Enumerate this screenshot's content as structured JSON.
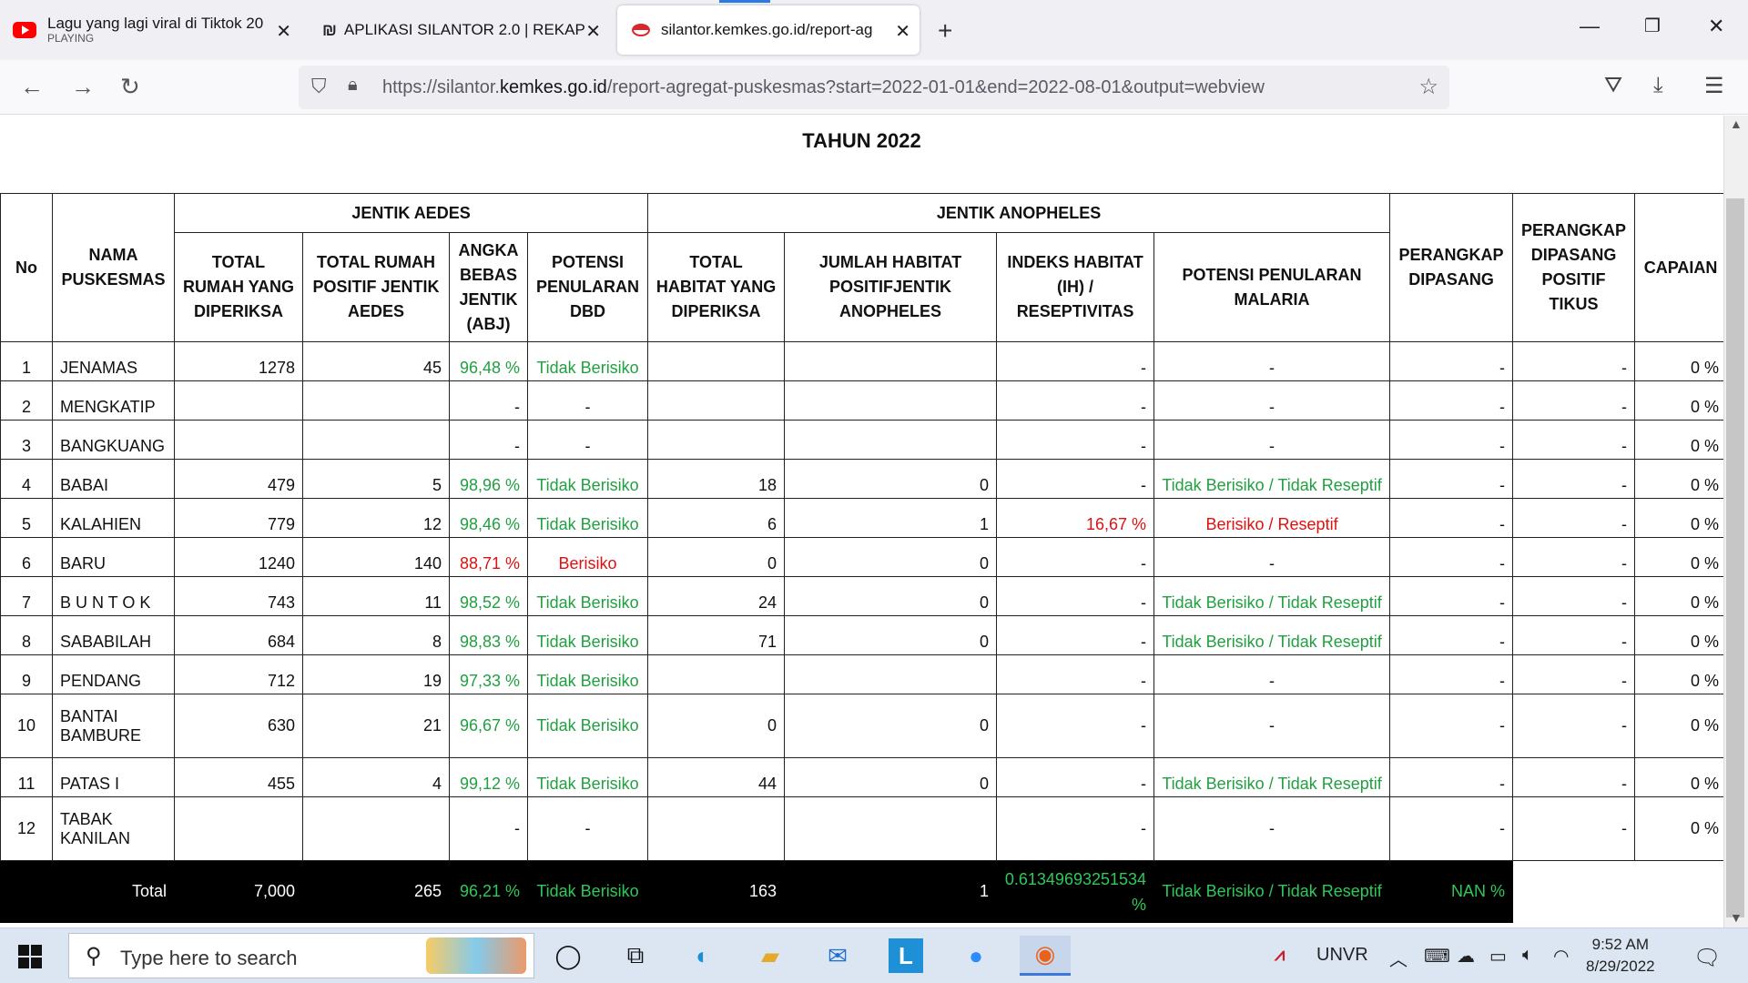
{
  "browser": {
    "tabs": [
      {
        "title": "Lagu yang lagi viral di Tiktok 20",
        "subtitle": "PLAYING",
        "icon": "youtube-icon"
      },
      {
        "title": "APLIKASI SILANTOR 2.0 | REKAP",
        "icon": "silantor-icon"
      },
      {
        "title": "silantor.kemkes.go.id/report-ag",
        "icon": "kemkes-icon",
        "active": true
      }
    ],
    "url_prefix": "https://silantor.",
    "url_domain": "kemkes.go.id",
    "url_path": "/report-agregat-puskesmas?start=2022-01-01&end=2022-08-01&output=webview"
  },
  "page": {
    "title": "TAHUN 2022",
    "headers": {
      "no": "No",
      "nama": "NAMA PUSKESMAS",
      "group_aedes": "JENTIK AEDES",
      "group_anopheles": "JENTIK ANOPHELES",
      "total_rumah": "TOTAL RUMAH YANG DIPERIKSA",
      "total_positif": "TOTAL RUMAH POSITIF JENTIK AEDES",
      "abj": "ANGKA BEBAS JENTIK (ABJ)",
      "potensi_dbd": "POTENSI PENULARAN DBD",
      "total_habitat": "TOTAL HABITAT YANG DIPERIKSA",
      "jumlah_habitat": "JUMLAH HABITAT POSITIFJENTIK ANOPHELES",
      "indeks": "INDEKS HABITAT (IH) / RESEPTIVITAS",
      "potensi_malaria": "POTENSI PENULARAN MALARIA",
      "perangkap": "PERANGKAP DIPASANG",
      "perangkap_positif": "PERANGKAP DIPASANG POSITIF TIKUS",
      "capaian": "CAPAIAN"
    },
    "rows": [
      {
        "no": "1",
        "nama": "JENAMAS",
        "rumah": "1278",
        "positif": "45",
        "abj": "96,48 %",
        "dbd": "Tidak Berisiko",
        "habitat": "",
        "jumlah": "",
        "indeks": "-",
        "malaria": "-",
        "perangkap": "-",
        "positif_tikus": "-",
        "capaian": "0 %"
      },
      {
        "no": "2",
        "nama": "MENGKATIP",
        "rumah": "",
        "positif": "",
        "abj": "-",
        "dbd": "-",
        "habitat": "",
        "jumlah": "",
        "indeks": "-",
        "malaria": "-",
        "perangkap": "-",
        "positif_tikus": "-",
        "capaian": "0 %"
      },
      {
        "no": "3",
        "nama": "BANGKUANG",
        "rumah": "",
        "positif": "",
        "abj": "-",
        "dbd": "-",
        "habitat": "",
        "jumlah": "",
        "indeks": "-",
        "malaria": "-",
        "perangkap": "-",
        "positif_tikus": "-",
        "capaian": "0 %"
      },
      {
        "no": "4",
        "nama": "BABAI",
        "rumah": "479",
        "positif": "5",
        "abj": "98,96 %",
        "dbd": "Tidak Berisiko",
        "habitat": "18",
        "jumlah": "0",
        "indeks": "-",
        "malaria": "Tidak Berisiko / Tidak Reseptif",
        "perangkap": "-",
        "positif_tikus": "-",
        "capaian": "0 %"
      },
      {
        "no": "5",
        "nama": "KALAHIEN",
        "rumah": "779",
        "positif": "12",
        "abj": "98,46 %",
        "dbd": "Tidak Berisiko",
        "habitat": "6",
        "jumlah": "1",
        "indeks": "16,67 %",
        "malaria": "Berisiko / Reseptif",
        "perangkap": "-",
        "positif_tikus": "-",
        "capaian": "0 %"
      },
      {
        "no": "6",
        "nama": "BARU",
        "rumah": "1240",
        "positif": "140",
        "abj": "88,71 %",
        "dbd": "Berisiko",
        "habitat": "0",
        "jumlah": "0",
        "indeks": "-",
        "malaria": "-",
        "perangkap": "-",
        "positif_tikus": "-",
        "capaian": "0 %"
      },
      {
        "no": "7",
        "nama": "B U N T O K",
        "rumah": "743",
        "positif": "11",
        "abj": "98,52 %",
        "dbd": "Tidak Berisiko",
        "habitat": "24",
        "jumlah": "0",
        "indeks": "-",
        "malaria": "Tidak Berisiko / Tidak Reseptif",
        "perangkap": "-",
        "positif_tikus": "-",
        "capaian": "0 %"
      },
      {
        "no": "8",
        "nama": "SABABILAH",
        "rumah": "684",
        "positif": "8",
        "abj": "98,83 %",
        "dbd": "Tidak Berisiko",
        "habitat": "71",
        "jumlah": "0",
        "indeks": "-",
        "malaria": "Tidak Berisiko / Tidak Reseptif",
        "perangkap": "-",
        "positif_tikus": "-",
        "capaian": "0 %"
      },
      {
        "no": "9",
        "nama": "PENDANG",
        "rumah": "712",
        "positif": "19",
        "abj": "97,33 %",
        "dbd": "Tidak Berisiko",
        "habitat": "",
        "jumlah": "",
        "indeks": "-",
        "malaria": "-",
        "perangkap": "-",
        "positif_tikus": "-",
        "capaian": "0 %"
      },
      {
        "no": "10",
        "nama": "BANTAI BAMBURE",
        "rumah": "630",
        "positif": "21",
        "abj": "96,67 %",
        "dbd": "Tidak Berisiko",
        "habitat": "0",
        "jumlah": "0",
        "indeks": "-",
        "malaria": "-",
        "perangkap": "-",
        "positif_tikus": "-",
        "capaian": "0 %"
      },
      {
        "no": "11",
        "nama": "PATAS I",
        "rumah": "455",
        "positif": "4",
        "abj": "99,12 %",
        "dbd": "Tidak Berisiko",
        "habitat": "44",
        "jumlah": "0",
        "indeks": "-",
        "malaria": "Tidak Berisiko / Tidak Reseptif",
        "perangkap": "-",
        "positif_tikus": "-",
        "capaian": "0 %"
      },
      {
        "no": "12",
        "nama": "TABAK KANILAN",
        "rumah": "",
        "positif": "",
        "abj": "-",
        "dbd": "-",
        "habitat": "",
        "jumlah": "",
        "indeks": "-",
        "malaria": "-",
        "perangkap": "-",
        "positif_tikus": "-",
        "capaian": "0 %"
      }
    ],
    "total": {
      "label": "Total",
      "rumah": "7,000",
      "positif": "265",
      "abj": "96,21 %",
      "dbd": "Tidak Berisiko",
      "habitat": "163",
      "jumlah": "1",
      "indeks": "0.61349693251534 %",
      "malaria": "Tidak Berisiko / Tidak Reseptif",
      "capaian": "NAN %"
    }
  },
  "taskbar": {
    "search_placeholder": "Type here to search",
    "ticker": "UNVR",
    "time": "9:52 AM",
    "date": "8/29/2022"
  },
  "colors": {
    "safe": "#20a040",
    "risk": "#e01010",
    "accent": "#2a7ae2"
  }
}
